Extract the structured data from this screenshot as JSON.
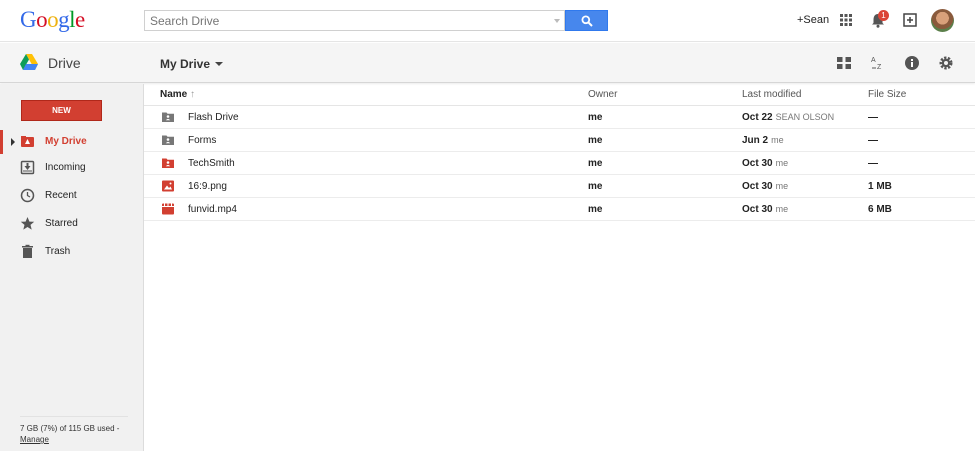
{
  "app": {
    "logo_letters": [
      {
        "ch": "G",
        "color": "#3369e8"
      },
      {
        "ch": "o",
        "color": "#d50f25"
      },
      {
        "ch": "o",
        "color": "#eeb211"
      },
      {
        "ch": "g",
        "color": "#3369e8"
      },
      {
        "ch": "l",
        "color": "#009925"
      },
      {
        "ch": "e",
        "color": "#d50f25"
      }
    ],
    "search_placeholder": "Search Drive",
    "user_label": "+Sean",
    "notification_count": "1"
  },
  "subbar": {
    "product_name": "Drive",
    "breadcrumb": "My Drive"
  },
  "sidebar": {
    "new_label": "NEW",
    "items": [
      {
        "label": "My Drive",
        "icon": "my-drive-icon",
        "active": true
      },
      {
        "label": "Incoming",
        "icon": "incoming-icon",
        "active": false
      },
      {
        "label": "Recent",
        "icon": "clock-icon",
        "active": false
      },
      {
        "label": "Starred",
        "icon": "star-icon",
        "active": false
      },
      {
        "label": "Trash",
        "icon": "trash-icon",
        "active": false
      }
    ],
    "storage_text": "7 GB (7%) of 115 GB used -",
    "manage_label": "Manage"
  },
  "table": {
    "headers": {
      "name": "Name",
      "sort_arrow": "↑",
      "owner": "Owner",
      "modified": "Last modified",
      "size": "File Size"
    },
    "rows": [
      {
        "name": "Flash Drive",
        "type": "shared-folder-icon",
        "owner": "me",
        "modified": "Oct 22",
        "modified_by": "SEAN OLSON",
        "size": "—"
      },
      {
        "name": "Forms",
        "type": "shared-folder-icon",
        "owner": "me",
        "modified": "Jun 2",
        "modified_by": "me",
        "size": "—"
      },
      {
        "name": "TechSmith",
        "type": "red-shared-folder-icon",
        "owner": "me",
        "modified": "Oct 30",
        "modified_by": "me",
        "size": "—"
      },
      {
        "name": "16:9.png",
        "type": "image-file-icon",
        "owner": "me",
        "modified": "Oct 30",
        "modified_by": "me",
        "size": "1 MB"
      },
      {
        "name": "funvid.mp4",
        "type": "video-file-icon",
        "owner": "me",
        "modified": "Oct 30",
        "modified_by": "me",
        "size": "6 MB"
      }
    ]
  },
  "colors": {
    "accent_red": "#d23f31",
    "search_blue": "#4787ed"
  }
}
